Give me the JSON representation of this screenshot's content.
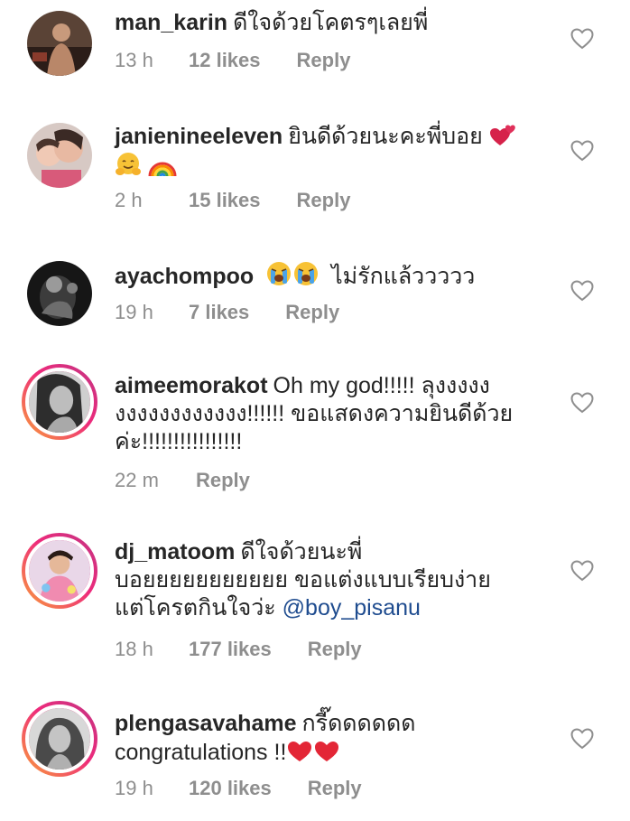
{
  "comments": [
    {
      "username": "man_karin",
      "text": "ดีใจด้วยโคตรๆเลยพี่",
      "time": "13 h",
      "likes": "12 likes",
      "reply": "Reply",
      "story_ring": false
    },
    {
      "username": "janienineeleven",
      "text_line1": "ยินดีด้วยนะคะพี่บอย",
      "emojis": [
        "two-hearts",
        "hugging-face",
        "rainbow"
      ],
      "time": "2 h",
      "likes": "15 likes",
      "reply": "Reply",
      "story_ring": false
    },
    {
      "username": "ayachompoo",
      "emojis": [
        "loudly-crying-face",
        "loudly-crying-face"
      ],
      "text": "ไม่รักแล้ววววว",
      "time": "19 h",
      "likes": "7 likes",
      "reply": "Reply",
      "story_ring": false
    },
    {
      "username": "aimeemorakot",
      "text_line1": "Oh my god!!!!! ลุงงงงง",
      "text_line2": "งงงงงงงงงงงง!!!!!! ขอแสดงความยินดีด้วย",
      "text_line3": "ค่ะ!!!!!!!!!!!!!!!!",
      "time": "22 m",
      "reply": "Reply",
      "story_ring": true
    },
    {
      "username": "dj_matoom",
      "text_line1": "ดีใจด้วยนะพี่",
      "text_line2": "บอยยยยยยยยยยย ขอแต่งแบบเรียบง่าย",
      "text_line3": "แต่โครตกินใจว่ะ",
      "mention": "@boy_pisanu",
      "time": "18 h",
      "likes": "177 likes",
      "reply": "Reply",
      "story_ring": true
    },
    {
      "username": "plengasavahame",
      "text_line1": "กรี๊ดดดดดด",
      "text_line2": "congratulations !!",
      "emojis": [
        "red-heart",
        "red-heart"
      ],
      "time": "19 h",
      "likes": "120 likes",
      "reply": "Reply",
      "story_ring": true
    }
  ],
  "colors": {
    "text": "#262626",
    "meta": "#8e8e8e",
    "mention": "#1f4c8f",
    "ring_start": "#f9a13a",
    "ring_end": "#c13584"
  }
}
